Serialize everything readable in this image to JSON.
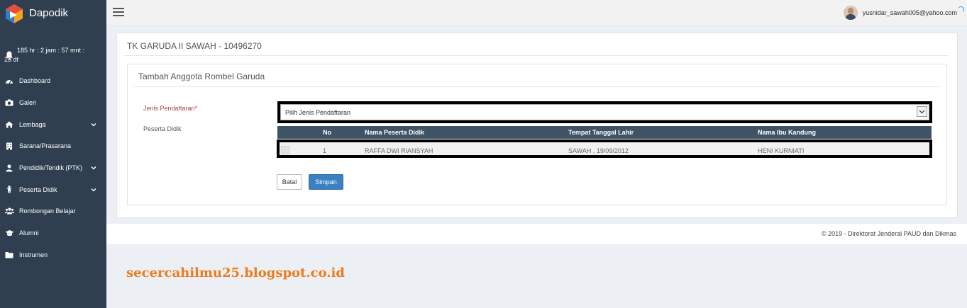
{
  "app": {
    "name": "Dapodik"
  },
  "timer": {
    "line1": "185 hr : 2 jam : 57 mnt :",
    "line2": "23 dt"
  },
  "sidebar": {
    "items": [
      {
        "label": "Dashboard",
        "icon": "dashboard-icon",
        "has_submenu": false
      },
      {
        "label": "Galeri",
        "icon": "camera-icon",
        "has_submenu": false
      },
      {
        "label": "Lembaga",
        "icon": "home-icon",
        "has_submenu": true
      },
      {
        "label": "Sarana/Prasarana",
        "icon": "building-icon",
        "has_submenu": false
      },
      {
        "label": "Pendidik/Tendik (PTK)",
        "icon": "user-icon",
        "has_submenu": true
      },
      {
        "label": "Peserta Didik",
        "icon": "child-icon",
        "has_submenu": true
      },
      {
        "label": "Rombongan Belajar",
        "icon": "users-icon",
        "has_submenu": false
      },
      {
        "label": "Alumni",
        "icon": "graduation-cap-icon",
        "has_submenu": false
      },
      {
        "label": "Instrumen",
        "icon": "folder-icon",
        "has_submenu": false
      }
    ]
  },
  "topbar": {
    "user_email": "yusnidar_sawah005@yahoo.com"
  },
  "page": {
    "school_title": "TK GARUDA II SAWAH - 10496270",
    "form_title": "Tambah Anggota Rombel Garuda",
    "label_jenis": "Jenis Pendaftaran*",
    "label_peserta": "Peserta Didik",
    "select_value": "Pilih Jenis Pendaftaran"
  },
  "table": {
    "headers": [
      "No",
      "Nama Peserta Didik",
      "Tempat Tanggal Lahir",
      "Nama Ibu Kandung"
    ],
    "rows": [
      {
        "no": "1",
        "nama": "RAFFA DWI RIANSYAH",
        "ttl": "SAWAH , 19/09/2012",
        "ibu": "HENI KURNIATI",
        "checked": false
      }
    ]
  },
  "buttons": {
    "batal": "Batal",
    "simpan": "Simpan"
  },
  "footer": {
    "text": "©   2019 - Direktorat Jenderal PAUD dan Dikmas"
  },
  "watermark": {
    "text": "secercahilmu25.blogspot.co.id"
  },
  "colors": {
    "sidebar": "#2f3f50",
    "table_header": "#3f5366",
    "primary": "#3b80c3",
    "required_label": "#a94442",
    "watermark": "#ee7a1a"
  }
}
